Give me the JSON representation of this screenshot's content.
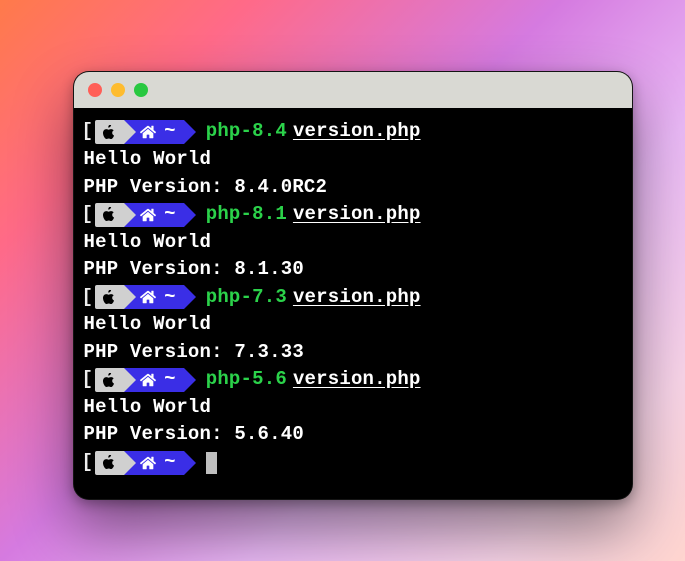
{
  "colors": {
    "os_bg": "#d0d0d0",
    "dir_bg": "#3a2ee6",
    "cmd": "#2bd24a",
    "fg": "#ffffff",
    "bg": "#000000",
    "titlebar": "#d9d9d3",
    "close": "#ff5f57",
    "min": "#febc2e",
    "max": "#28c840"
  },
  "prompt": {
    "os_icon": "apple-icon",
    "home_icon": "home-icon",
    "tilde": "~",
    "open_bracket": "[",
    "close_bracket": ""
  },
  "arg_filename": "version.php",
  "sessions": [
    {
      "command": "php-8.4",
      "output": [
        "Hello World",
        "PHP Version: 8.4.0RC2"
      ]
    },
    {
      "command": "php-8.1",
      "output": [
        "Hello World",
        "PHP Version: 8.1.30"
      ]
    },
    {
      "command": "php-7.3",
      "output": [
        "Hello World",
        "PHP Version: 7.3.33"
      ]
    },
    {
      "command": "php-5.6",
      "output": [
        "Hello World",
        "PHP Version: 5.6.40"
      ]
    }
  ],
  "final_prompt": {
    "show_cursor": true
  }
}
